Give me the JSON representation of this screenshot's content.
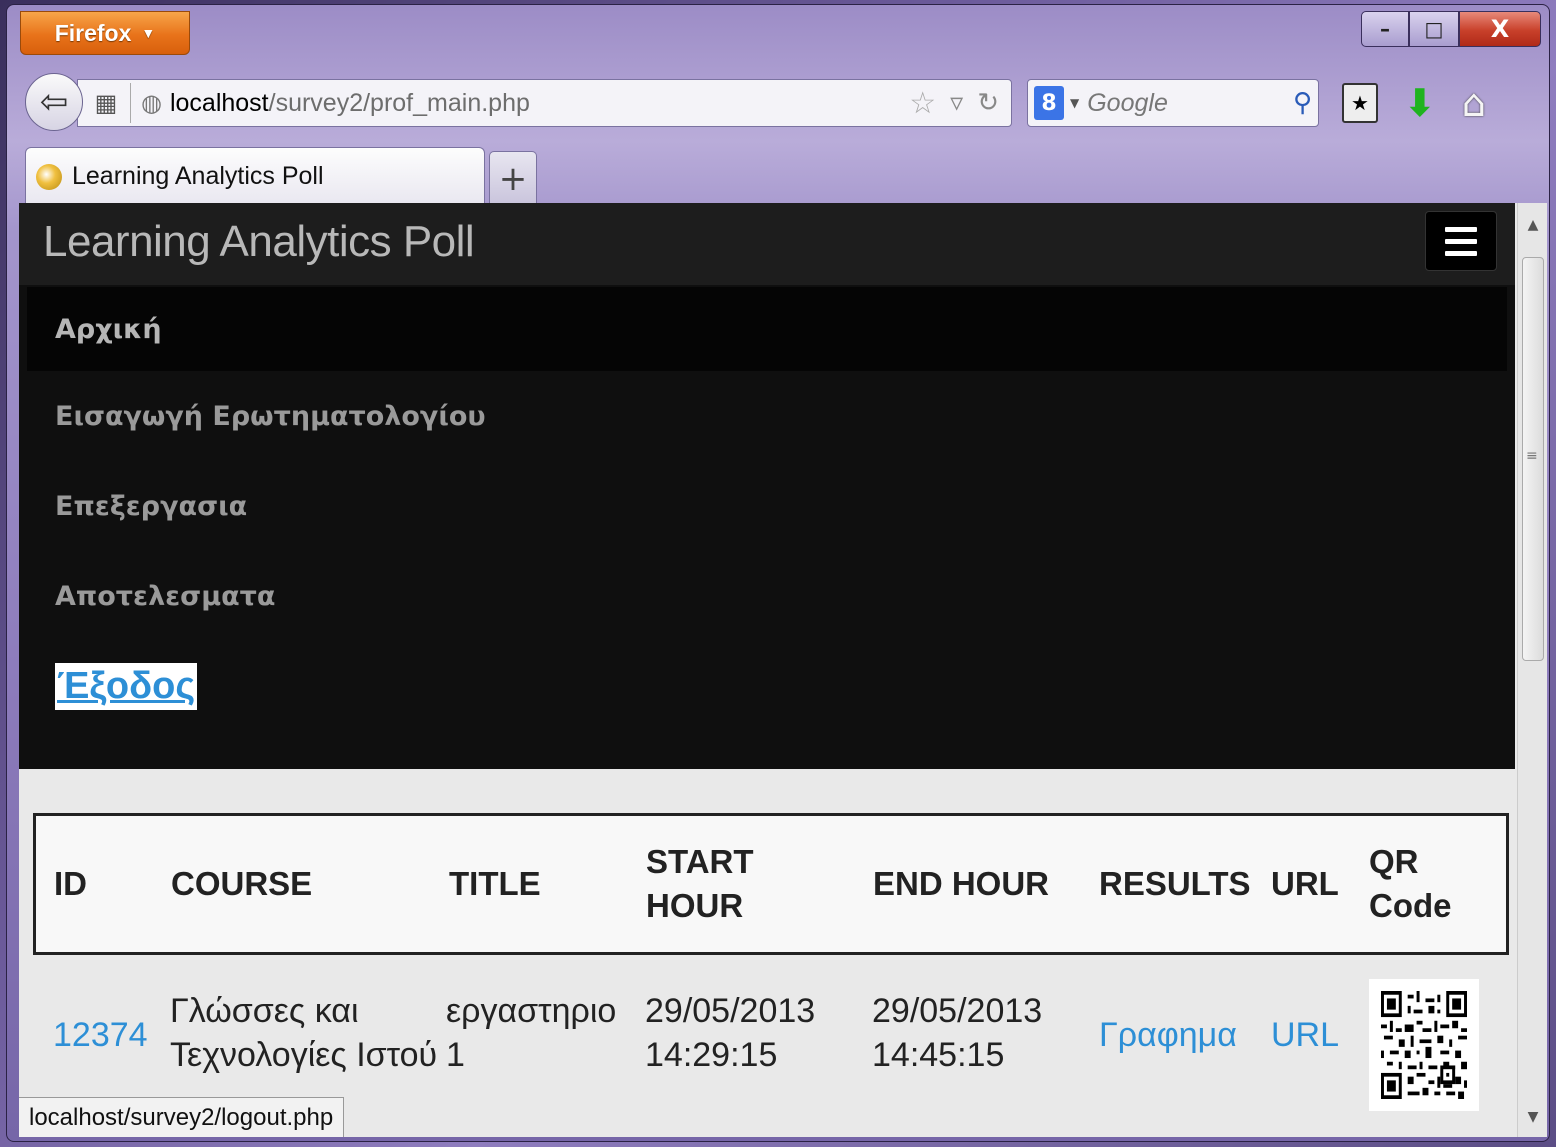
{
  "browser": {
    "app_button": "Firefox",
    "url_host": "localhost",
    "url_path": "/survey2/prof_main.php",
    "search_placeholder": "Google",
    "tab_title": "Learning Analytics Poll",
    "new_tab": "+",
    "status_url": "localhost/survey2/logout.php",
    "win_min": "–",
    "win_max": "□",
    "win_close": "X"
  },
  "navbar": {
    "brand": "Learning Analytics Poll",
    "menu": [
      {
        "label": "Αρχική",
        "active": true
      },
      {
        "label": "Εισαγωγή Ερωτηματολογίου"
      },
      {
        "label": "Επεξεργασια"
      },
      {
        "label": "Αποτελεσματα"
      }
    ],
    "logout": "Έξοδος"
  },
  "table": {
    "headers": {
      "id": "ID",
      "course": "COURSE",
      "title": "TITLE",
      "start_1": "START",
      "start_2": "HOUR",
      "end": "END HOUR",
      "results": "RESULTS",
      "url": "URL",
      "qr_1": "QR",
      "qr_2": "Code"
    },
    "rows": [
      {
        "id": "12374",
        "course_1": "Γλώσσες και",
        "course_2": "Τεχνολογίες Ιστού",
        "title_1": "εργαστηριο",
        "title_2": "1",
        "start_date": "29/05/2013",
        "start_time": "14:29:15",
        "end_date": "29/05/2013",
        "end_time": "14:45:15",
        "results": "Γραφημα",
        "url": "URL"
      }
    ]
  },
  "colors": {
    "link": "#2d8fd6",
    "navbar_bg": "#0f0f0f",
    "firefox_orange": "#e8731a"
  }
}
